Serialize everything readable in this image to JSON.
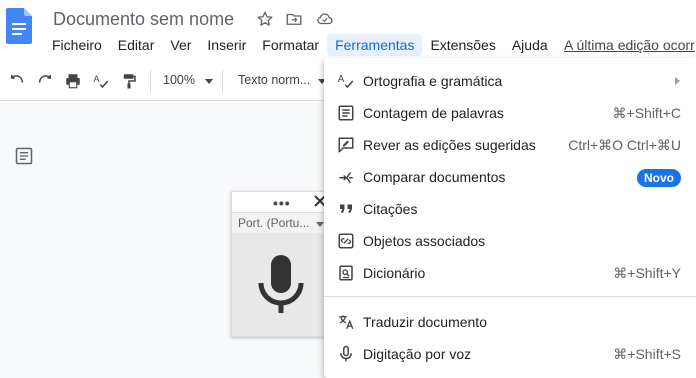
{
  "app": {
    "document_title": "Documento sem nome",
    "last_edit": "A última edição ocorr"
  },
  "menubar": {
    "items": [
      "Ficheiro",
      "Editar",
      "Ver",
      "Inserir",
      "Formatar",
      "Ferramentas",
      "Extensões",
      "Ajuda"
    ],
    "active": "Ferramentas"
  },
  "toolbar": {
    "zoom": "100%",
    "style": "Texto norm..."
  },
  "voice_widget": {
    "language": "Port. (Portu..."
  },
  "tools_menu": {
    "items": [
      {
        "label": "Ortografia e gramática",
        "icon": "spellcheck-icon",
        "submenu": true
      },
      {
        "label": "Contagem de palavras",
        "icon": "word-count-icon",
        "shortcut": "⌘+Shift+C"
      },
      {
        "label": "Rever as edições sugeridas",
        "icon": "review-edits-icon",
        "shortcut": "Ctrl+⌘O Ctrl+⌘U"
      },
      {
        "label": "Comparar documentos",
        "icon": "compare-icon",
        "badge": "Novo"
      },
      {
        "label": "Citações",
        "icon": "quote-icon"
      },
      {
        "label": "Objetos associados",
        "icon": "linked-objects-icon"
      },
      {
        "label": "Dicionário",
        "icon": "dictionary-icon",
        "shortcut": "⌘+Shift+Y"
      },
      {
        "label": "Traduzir documento",
        "icon": "translate-icon"
      },
      {
        "label": "Digitação por voz",
        "icon": "mic-icon",
        "shortcut": "⌘+Shift+S"
      }
    ]
  },
  "colors": {
    "accent": "#1a73e8",
    "active_menu_bg": "#e8f0fe",
    "docs_blue": "#4285f4"
  }
}
